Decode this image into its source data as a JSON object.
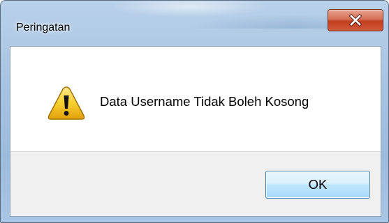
{
  "window": {
    "title": "Peringatan",
    "close_icon": "close-icon"
  },
  "message": {
    "icon": "warning-icon",
    "text": "Data Username Tidak Boleh Kosong"
  },
  "buttons": {
    "ok_label": "OK"
  },
  "colors": {
    "frame": "#a8c4e2",
    "close_button": "#c23f1f",
    "ok_button_border": "#3c7fb1",
    "warning_fill": "#f5c21a"
  }
}
